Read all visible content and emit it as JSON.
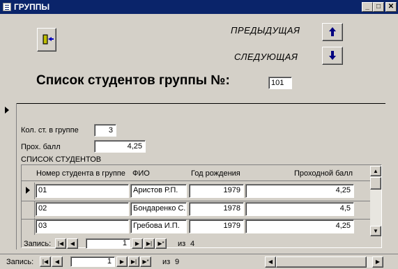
{
  "window": {
    "title": "ГРУППЫ"
  },
  "nav": {
    "prev_label": "ПРЕДЫДУЩАЯ",
    "next_label": "СЛЕДУЮЩАЯ"
  },
  "header": {
    "title": "Список студентов группы №:",
    "group_number": "101"
  },
  "fields": {
    "count_label": "Кол. ст. в группе",
    "count_value": "3",
    "avg_label": "Прох. балл",
    "avg_value": "4,25"
  },
  "subform": {
    "title": "СПИСОК СТУДЕНТОВ",
    "columns": [
      "Номер студента в группе",
      "ФИО",
      "Год рождения",
      "Проходной балл"
    ],
    "rows": [
      {
        "num": "01",
        "fio": "Аристов Р.П.",
        "year": "1979",
        "score": "4,25"
      },
      {
        "num": "02",
        "fio": "Бондаренко С.",
        "year": "1978",
        "score": "4,5"
      },
      {
        "num": "03",
        "fio": "Гребова И.П.",
        "year": "1979",
        "score": "4,25"
      }
    ],
    "record_label": "Запись:",
    "record_current": "1",
    "record_of": "из",
    "record_total": "4"
  },
  "main_record": {
    "label": "Запись:",
    "current": "1",
    "of": "из",
    "total": "9"
  },
  "icons": {
    "exit": "exit-door-icon",
    "prev": "arrow-up-icon",
    "next": "arrow-down-icon"
  }
}
